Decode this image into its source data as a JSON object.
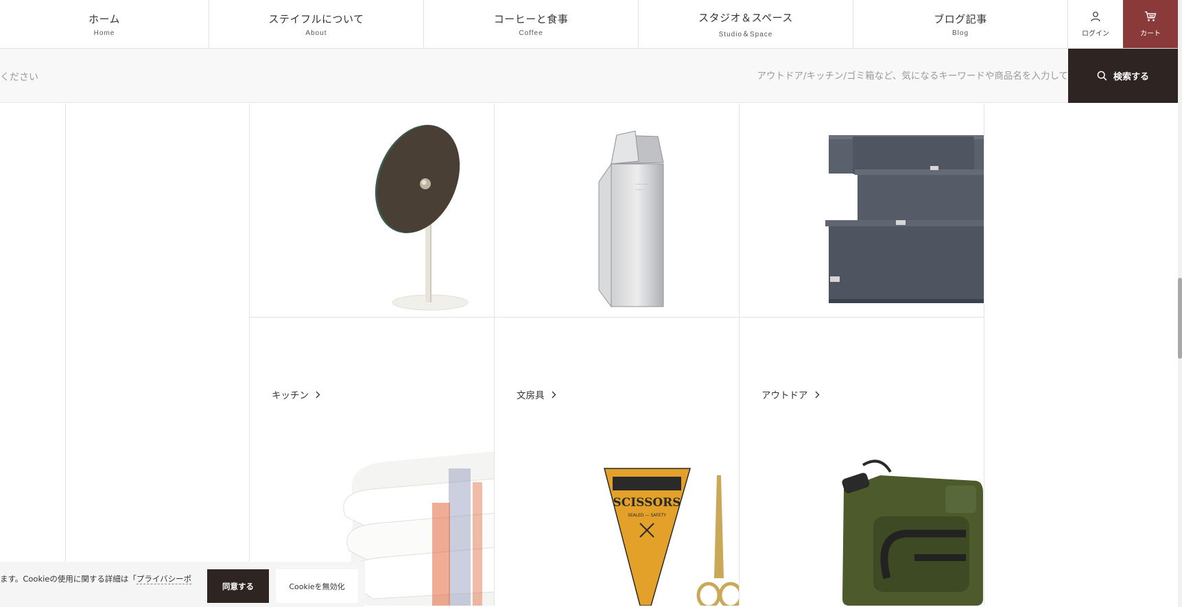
{
  "nav": {
    "items": [
      {
        "ja": "ホーム",
        "en": "Home"
      },
      {
        "ja": "ステイフルについて",
        "en": "About"
      },
      {
        "ja": "コーヒーと食事",
        "en": "Coffee"
      },
      {
        "ja": "スタジオ＆スペース",
        "en": "Studio＆Space"
      },
      {
        "ja": "ブログ記事",
        "en": "Blog"
      }
    ],
    "login_label": "ログイン",
    "cart_label": "カート"
  },
  "search": {
    "left_overflow_text": "ください",
    "placeholder": "アウトドア/キッチン/ゴミ箱など、気になるキーワードや商品名を入力して",
    "button_label": "検索する"
  },
  "categories": [
    {
      "label": "キッチン"
    },
    {
      "label": "文房具"
    },
    {
      "label": "アウトドア"
    }
  ],
  "cookie": {
    "text_before": "ます。Cookieの使用に関する詳細は「",
    "link_text": "プライバシーポ",
    "agree_label": "同意する",
    "disable_label": "Cookieを無効化"
  },
  "colors": {
    "accent": "#8b3a3a",
    "dark": "#2e2523",
    "border": "#e3e3e3"
  }
}
